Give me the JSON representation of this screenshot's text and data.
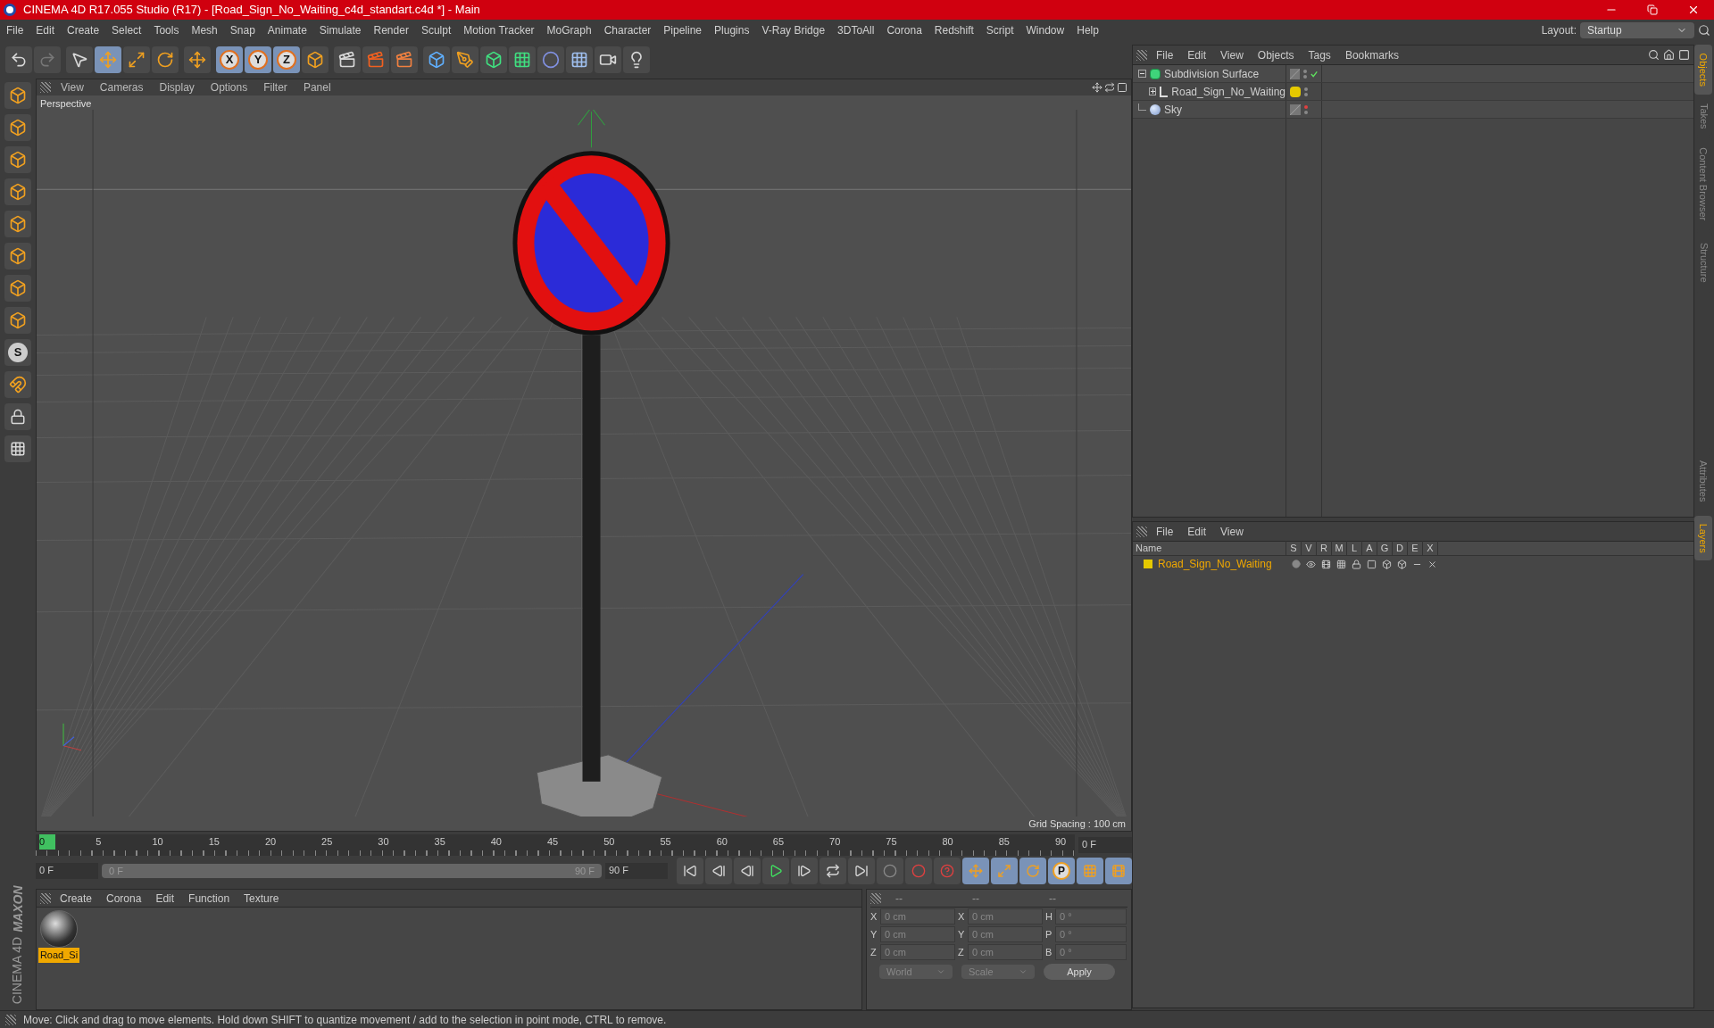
{
  "window": {
    "title": "CINEMA 4D R17.055 Studio (R17) - [Road_Sign_No_Waiting_c4d_standart.c4d *] - Main"
  },
  "menu": [
    "File",
    "Edit",
    "Create",
    "Select",
    "Tools",
    "Mesh",
    "Snap",
    "Animate",
    "Simulate",
    "Render",
    "Sculpt",
    "Motion Tracker",
    "MoGraph",
    "Character",
    "Pipeline",
    "Plugins",
    "V-Ray Bridge",
    "3DToAll",
    "Corona",
    "Redshift",
    "Script",
    "Window",
    "Help"
  ],
  "layout": {
    "label": "Layout:",
    "value": "Startup"
  },
  "toolbar": {
    "axis_locks": [
      "X",
      "Y",
      "Z"
    ]
  },
  "left_tools": {
    "letter_tool": "S"
  },
  "logo": {
    "brand": "MAXON",
    "product": "CINEMA 4D"
  },
  "viewport": {
    "menu": [
      "View",
      "Cameras",
      "Display",
      "Options",
      "Filter",
      "Panel"
    ],
    "camera": "Perspective",
    "grid_spacing": "Grid Spacing : 100 cm"
  },
  "object_manager": {
    "menu": [
      "File",
      "Edit",
      "View",
      "Objects",
      "Tags",
      "Bookmarks"
    ],
    "objects": [
      {
        "name": "Subdivision Surface",
        "kind": "subdivision",
        "expanded": true,
        "enabled": true,
        "children": [
          {
            "name": "Road_Sign_No_Waiting",
            "kind": "null",
            "expanded": false,
            "color": "#e5c900"
          }
        ]
      },
      {
        "name": "Sky",
        "kind": "sky",
        "enabled": false
      }
    ]
  },
  "side_tabs_top": [
    {
      "label": "Objects",
      "selected": true
    },
    {
      "label": "Takes",
      "selected": false
    },
    {
      "label": "Content Browser",
      "selected": false
    },
    {
      "label": "Structure",
      "selected": false
    }
  ],
  "side_tabs_bottom": [
    {
      "label": "Attributes",
      "selected": false
    },
    {
      "label": "Layers",
      "selected": true
    }
  ],
  "layer_manager": {
    "menu": [
      "File",
      "Edit",
      "View"
    ],
    "columns": [
      "Name",
      "S",
      "V",
      "R",
      "M",
      "L",
      "A",
      "G",
      "D",
      "E",
      "X"
    ],
    "layers": [
      {
        "name": "Road_Sign_No_Waiting",
        "color": "#e5c900"
      }
    ]
  },
  "timeline": {
    "ticks": [
      "0",
      "5",
      "10",
      "15",
      "20",
      "25",
      "30",
      "35",
      "40",
      "45",
      "50",
      "55",
      "60",
      "65",
      "70",
      "75",
      "80",
      "85",
      "90"
    ],
    "current_frame": "0 F",
    "start": "0 F",
    "frame_range": {
      "start": "0 F",
      "end": "90 F",
      "level": 1
    },
    "end": "90 F",
    "record_letter": "P"
  },
  "material_manager": {
    "menu": [
      "Create",
      "Corona",
      "Edit",
      "Function",
      "Texture"
    ],
    "materials": [
      {
        "name": "Road_Si",
        "selected": true
      }
    ]
  },
  "coordinates": {
    "headers": [
      "--",
      "--",
      "--"
    ],
    "rows": [
      {
        "axis": "X",
        "position": "0 cm",
        "size_axis": "X",
        "size": "0 cm",
        "rot_axis": "H",
        "rotation": "0 °"
      },
      {
        "axis": "Y",
        "position": "0 cm",
        "size_axis": "Y",
        "size": "0 cm",
        "rot_axis": "P",
        "rotation": "0 °"
      },
      {
        "axis": "Z",
        "position": "0 cm",
        "size_axis": "Z",
        "size": "0 cm",
        "rot_axis": "B",
        "rotation": "0 °"
      }
    ],
    "space": "World",
    "mode": "Scale",
    "apply": "Apply"
  },
  "status_bar": "Move: Click and drag to move elements. Hold down SHIFT to quantize movement / add to the selection in point mode, CTRL to remove."
}
